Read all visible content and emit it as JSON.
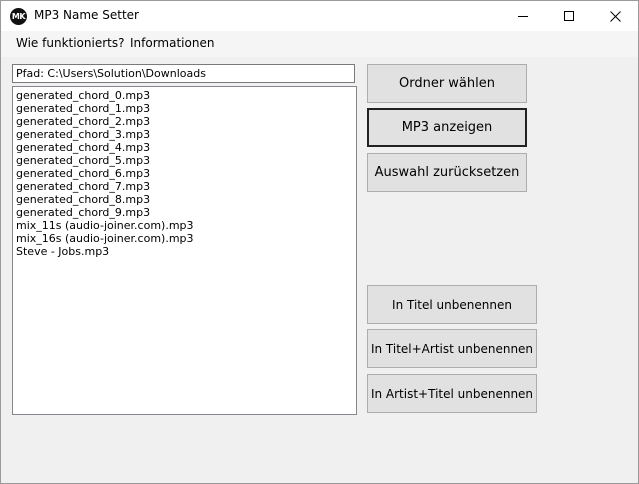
{
  "window": {
    "title": "MP3 Name Setter",
    "icon_text": "MK",
    "controls": {
      "minimize_icon": "minimize-icon",
      "maximize_icon": "maximize-icon",
      "close_icon": "close-icon"
    }
  },
  "menu": {
    "items": [
      "Wie funktionierts?",
      "Informationen"
    ]
  },
  "path": {
    "label": "Pfad: C:\\Users\\Solution\\Downloads"
  },
  "files": [
    "generated_chord_0.mp3",
    "generated_chord_1.mp3",
    "generated_chord_2.mp3",
    "generated_chord_3.mp3",
    "generated_chord_4.mp3",
    "generated_chord_5.mp3",
    "generated_chord_6.mp3",
    "generated_chord_7.mp3",
    "generated_chord_8.mp3",
    "generated_chord_9.mp3",
    "mix_11s (audio-joiner.com).mp3",
    "mix_16s (audio-joiner.com).mp3",
    "Steve - Jobs.mp3"
  ],
  "buttons": {
    "choose_folder": "Ordner wählen",
    "show_mp3": "MP3 anzeigen",
    "reset_selection": "Auswahl zurücksetzen",
    "rename_title": "In Titel unbenennen",
    "rename_title_artist": "In Titel+Artist unbenennen",
    "rename_artist_title": "In Artist+Titel unbenennen"
  }
}
